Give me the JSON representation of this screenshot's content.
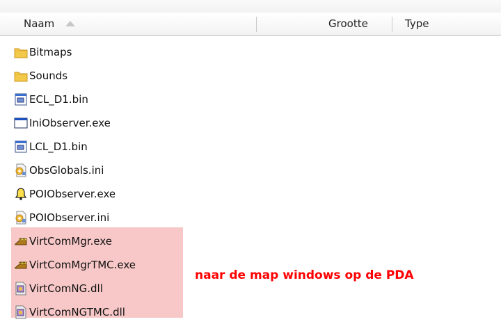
{
  "header": {
    "name_label": "Naam",
    "size_label": "Grootte",
    "type_label": "Type"
  },
  "files": [
    {
      "name": "Bitmaps",
      "icon": "folder-icon"
    },
    {
      "name": "Sounds",
      "icon": "folder-icon"
    },
    {
      "name": "ECL_D1.bin",
      "icon": "bin-file-icon"
    },
    {
      "name": "IniObserver.exe",
      "icon": "exe-window-icon"
    },
    {
      "name": "LCL_D1.bin",
      "icon": "bin-file-icon"
    },
    {
      "name": "ObsGlobals.ini",
      "icon": "ini-settings-icon"
    },
    {
      "name": "POIObserver.exe",
      "icon": "bell-icon"
    },
    {
      "name": "POIObserver.ini",
      "icon": "ini-settings-icon"
    },
    {
      "name": "VirtComMgr.exe",
      "icon": "serial-port-icon"
    },
    {
      "name": "VirtComMgrTMC.exe",
      "icon": "serial-port-icon"
    },
    {
      "name": "VirtComNG.dll",
      "icon": "dll-file-icon"
    },
    {
      "name": "VirtComNGTMC.dll",
      "icon": "dll-file-icon"
    }
  ],
  "annotation": {
    "text": "naar de map windows op de PDA",
    "color": "#ff0000"
  },
  "highlight_color": "#f8c8c8"
}
